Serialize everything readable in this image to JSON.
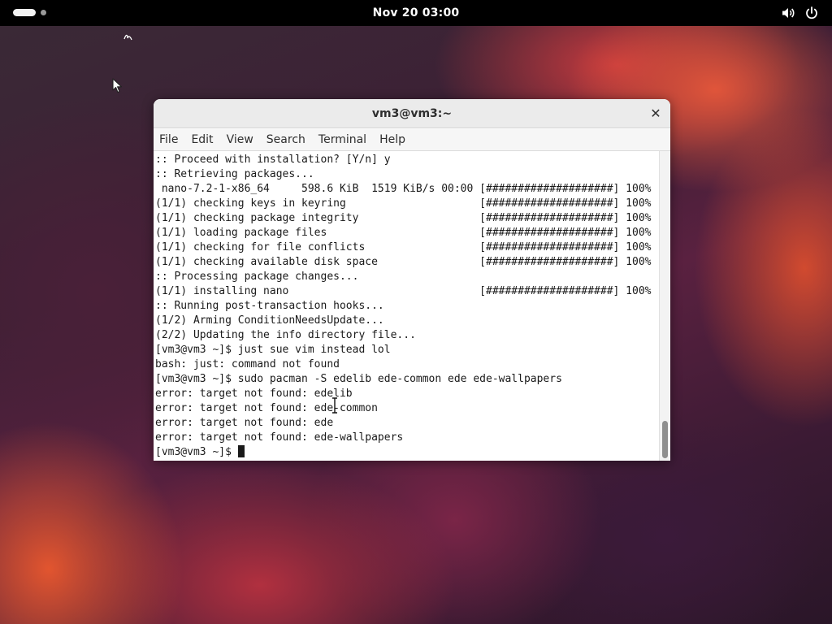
{
  "topbar": {
    "clock": "Nov 20  03:00",
    "icons": [
      "activities-pill",
      "workspace-dot",
      "volume-icon",
      "power-icon"
    ]
  },
  "window": {
    "title": "vm3@vm3:~",
    "close_icon": "close-icon",
    "menu": [
      "File",
      "Edit",
      "View",
      "Search",
      "Terminal",
      "Help"
    ],
    "terminal_lines": [
      ":: Proceed with installation? [Y/n] y",
      ":: Retrieving packages...",
      " nano-7.2-1-x86_64     598.6 KiB  1519 KiB/s 00:00 [####################] 100%",
      "(1/1) checking keys in keyring                     [####################] 100%",
      "(1/1) checking package integrity                   [####################] 100%",
      "(1/1) loading package files                        [####################] 100%",
      "(1/1) checking for file conflicts                  [####################] 100%",
      "(1/1) checking available disk space                [####################] 100%",
      ":: Processing package changes...",
      "(1/1) installing nano                              [####################] 100%",
      ":: Running post-transaction hooks...",
      "(1/2) Arming ConditionNeedsUpdate...",
      "(2/2) Updating the info directory file...",
      "[vm3@vm3 ~]$ just sue vim instead lol",
      "bash: just: command not found",
      "[vm3@vm3 ~]$ sudo pacman -S edelib ede-common ede ede-wallpapers",
      "error: target not found: edelib",
      "error: target not found: ede-common",
      "error: target not found: ede",
      "error: target not found: ede-wallpapers"
    ],
    "prompt": "[vm3@vm3 ~]$ "
  },
  "colors": {
    "topbar": "#000000",
    "titlebar": "#ebebeb",
    "terminal_bg": "#ffffff",
    "terminal_fg": "#1a1a1a"
  }
}
